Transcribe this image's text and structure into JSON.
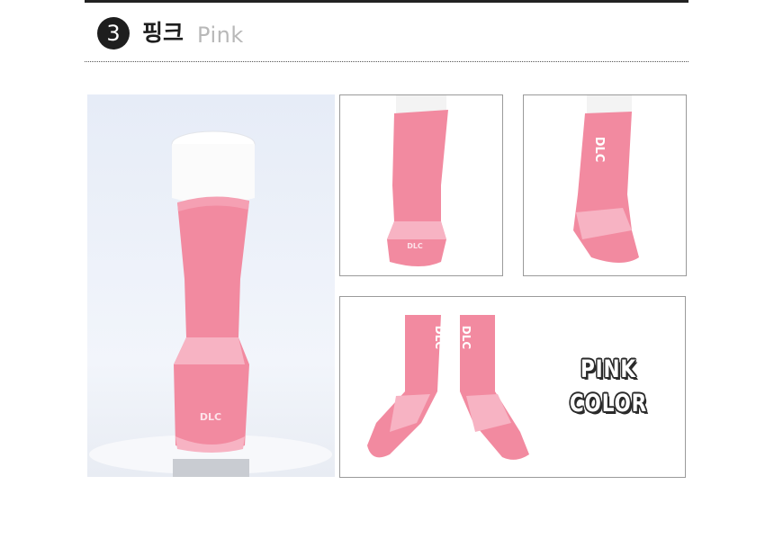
{
  "header": {
    "number": "3",
    "title_ko": "핑크",
    "title_en": "Pink"
  },
  "product_images": {
    "sock_logo": "DLC",
    "caption_line1": "PINK",
    "caption_line2": "COLOR"
  },
  "colors": {
    "sock_pink": "#f28aa0",
    "sock_light_pink": "#f7b3c3",
    "outline": "#9a9a9a"
  }
}
